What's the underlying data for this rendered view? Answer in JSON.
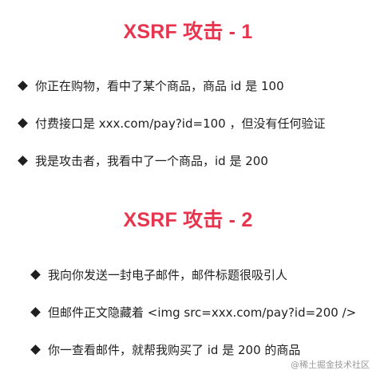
{
  "section1": {
    "title": "XSRF 攻击 - 1",
    "items": [
      "你正在购物，看中了某个商品，商品 id 是 100",
      "付费接口是 xxx.com/pay?id=100 ，但没有任何验证",
      "我是攻击者，我看中了一个商品，id 是 200"
    ]
  },
  "section2": {
    "title": "XSRF 攻击 - 2",
    "items": [
      "我向你发送一封电子邮件，邮件标题很吸引人",
      "但邮件正文隐藏着 <img src=xxx.com/pay?id=200 />",
      "你一查看邮件，就帮我购买了 id 是 200 的商品"
    ]
  },
  "watermark": "@稀土掘金技术社区",
  "colors": {
    "title": "#e8354f",
    "text": "#1f1f1f"
  },
  "icons": {
    "bullet": "diamond-icon"
  }
}
